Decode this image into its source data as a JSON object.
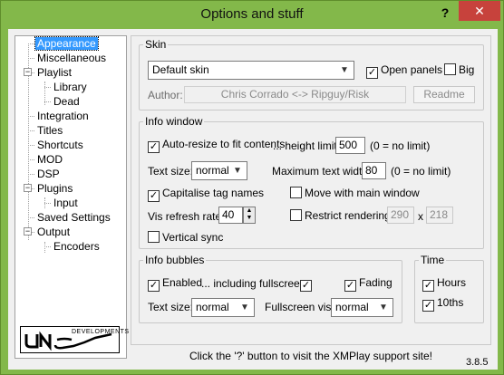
{
  "window": {
    "title": "Options and stuff",
    "help_label": "?",
    "close_label": "✕"
  },
  "tree": {
    "items": [
      {
        "label": "Appearance",
        "level": 1,
        "selected": true
      },
      {
        "label": "Miscellaneous",
        "level": 1
      },
      {
        "label": "Playlist",
        "level": 1,
        "expander": "−"
      },
      {
        "label": "Library",
        "level": 2
      },
      {
        "label": "Dead",
        "level": 2
      },
      {
        "label": "Integration",
        "level": 1
      },
      {
        "label": "Titles",
        "level": 1
      },
      {
        "label": "Shortcuts",
        "level": 1
      },
      {
        "label": "MOD",
        "level": 1
      },
      {
        "label": "DSP",
        "level": 1
      },
      {
        "label": "Plugins",
        "level": 1,
        "expander": "−"
      },
      {
        "label": "Input",
        "level": 2
      },
      {
        "label": "Saved Settings",
        "level": 1
      },
      {
        "label": "Output",
        "level": 1,
        "expander": "−"
      },
      {
        "label": "Encoders",
        "level": 2
      }
    ],
    "logo_text": "UN4SEEN",
    "logo_subtext": "DEVELOPMENTS"
  },
  "skin": {
    "legend": "Skin",
    "selected": "Default skin",
    "open_panels_label": "Open panels",
    "open_panels_checked": true,
    "big_label": "Big",
    "big_checked": false,
    "author_label": "Author:",
    "author_value": "Chris Corrado <-> Ripguy/Risk",
    "readme_label": "Readme"
  },
  "info_window": {
    "legend": "Info window",
    "auto_resize_label": "Auto-resize to fit contents",
    "auto_resize_checked": true,
    "height_limit_label": "... height limit:",
    "height_limit_value": "500",
    "height_limit_hint": "(0 = no limit)",
    "text_size_label": "Text size:",
    "text_size_value": "normal",
    "max_width_label": "Maximum text width:",
    "max_width_value": "80",
    "max_width_hint": "(0 = no limit)",
    "capitalise_label": "Capitalise tag names",
    "capitalise_checked": true,
    "move_main_label": "Move with main window",
    "move_main_checked": false,
    "vis_refresh_label": "Vis refresh rate:",
    "vis_refresh_value": "40",
    "restrict_label": "Restrict rendering:",
    "restrict_checked": false,
    "restrict_w": "290",
    "restrict_x": "x",
    "restrict_h": "218",
    "vsync_label": "Vertical sync",
    "vsync_checked": false
  },
  "info_bubbles": {
    "legend": "Info bubbles",
    "enabled_label": "Enabled",
    "enabled_checked": true,
    "fullscreen_label": "... including fullscreen",
    "fullscreen_checked": true,
    "fading_label": "Fading",
    "fading_checked": true,
    "text_size_label": "Text size:",
    "text_size_value": "normal",
    "fullscreen_vis_label": "Fullscreen vis:",
    "fullscreen_vis_value": "normal"
  },
  "time": {
    "legend": "Time",
    "hours_label": "Hours",
    "hours_checked": true,
    "tenths_label": "10ths",
    "tenths_checked": true
  },
  "footer": {
    "hint": "Click the '?' button to visit the XMPlay support site!",
    "version": "3.8.5"
  },
  "icons": {
    "check": "✓",
    "dropdown": "chevron-down-icon"
  },
  "colors": {
    "selection": "#3399ff",
    "frame": "#83b84a",
    "close": "#c7423c"
  }
}
